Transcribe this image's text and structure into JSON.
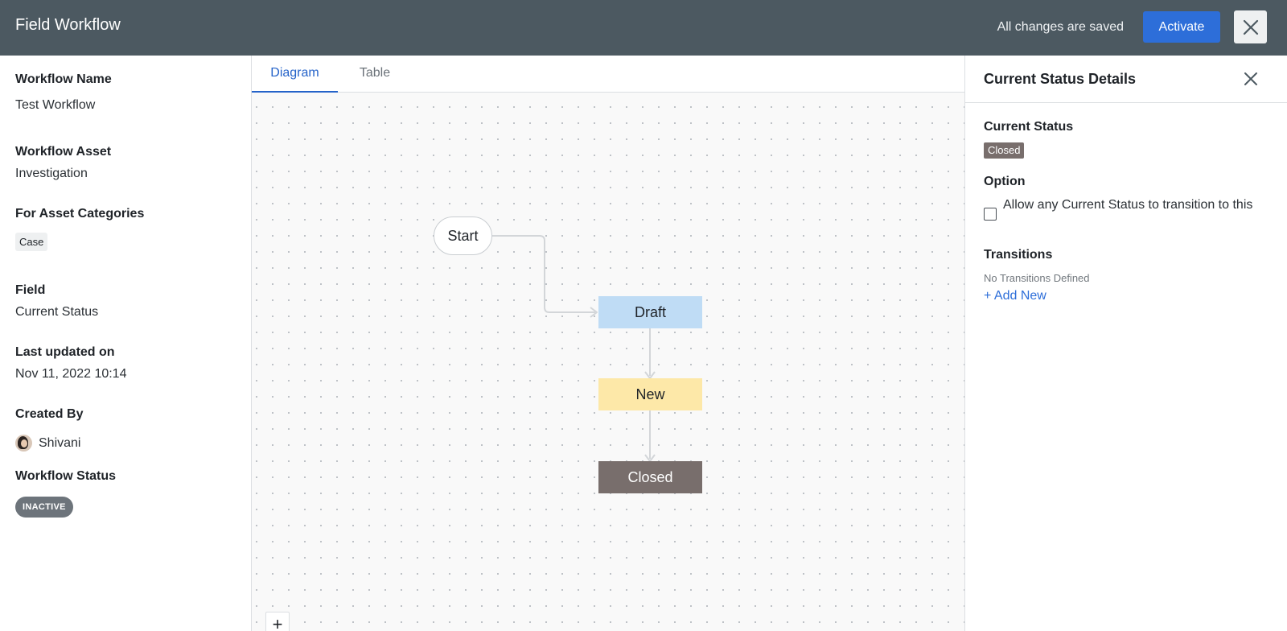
{
  "header": {
    "title": "Field Workflow",
    "save_status": "All changes are saved",
    "activate_label": "Activate",
    "close_icon": "close-icon"
  },
  "left_panel": {
    "workflow_name_label": "Workflow Name",
    "workflow_name": "Test Workflow",
    "workflow_asset_label": "Workflow Asset",
    "workflow_asset": "Investigation",
    "asset_categories_label": "For Asset Categories",
    "asset_categories": [
      "Case"
    ],
    "field_label": "Field",
    "field": "Current Status",
    "last_updated_label": "Last updated on",
    "last_updated": "Nov 11, 2022 10:14",
    "created_by_label": "Created By",
    "created_by": "Shivani",
    "workflow_status_label": "Workflow Status",
    "workflow_status": "INACTIVE"
  },
  "tabs": [
    {
      "label": "Diagram",
      "active": true
    },
    {
      "label": "Table",
      "active": false
    }
  ],
  "diagram": {
    "nodes": [
      {
        "id": "start",
        "label": "Start",
        "color": "#ffffff"
      },
      {
        "id": "draft",
        "label": "Draft",
        "color": "#bfdcf5"
      },
      {
        "id": "new",
        "label": "New",
        "color": "#fde8a8"
      },
      {
        "id": "closed",
        "label": "Closed",
        "color": "#786e6c"
      }
    ],
    "edges": [
      {
        "from": "start",
        "to": "draft"
      },
      {
        "from": "draft",
        "to": "new"
      },
      {
        "from": "new",
        "to": "closed"
      }
    ],
    "zoom_in_label": "+",
    "zoom_out_label": "−"
  },
  "right_panel": {
    "title": "Current Status Details",
    "current_status_label": "Current Status",
    "current_status": "Closed",
    "option_label": "Option",
    "option_checkbox_label": "Allow any Current Status to transition to this",
    "option_checked": false,
    "transitions_label": "Transitions",
    "transitions_empty": "No Transitions Defined",
    "add_new_label": "+ Add New"
  },
  "colors": {
    "header_bg": "#4c5961",
    "accent": "#2d6ed9",
    "closed": "#786e6c",
    "inactive_pill": "#6d747b"
  }
}
